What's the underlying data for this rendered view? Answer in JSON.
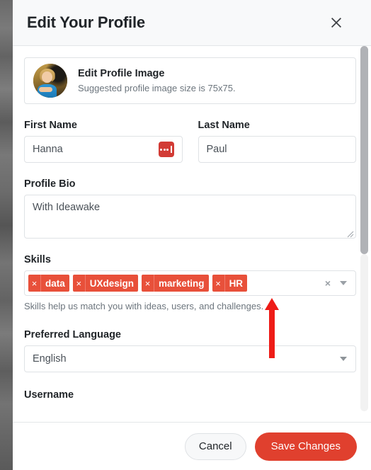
{
  "modal": {
    "title": "Edit Your Profile",
    "close_icon": "close-icon"
  },
  "profile_image_card": {
    "title": "Edit Profile Image",
    "subtitle": "Suggested profile image size is 75x75.",
    "avatar_alt": "user-avatar"
  },
  "fields": {
    "first_name": {
      "label": "First Name",
      "value": "Hanna",
      "placeholder": "First Name",
      "addon_icon": "lastpass-icon"
    },
    "last_name": {
      "label": "Last Name",
      "value": "Paul",
      "placeholder": "Last Name"
    },
    "profile_bio": {
      "label": "Profile Bio",
      "value": "With Ideawake",
      "placeholder": "Profile Bio"
    },
    "skills": {
      "label": "Skills",
      "chips": [
        "data",
        "UXdesign",
        "marketing",
        "HR"
      ],
      "remove_glyph": "×",
      "clear_glyph": "×",
      "help_text": "Skills help us match you with ideas, users, and challenges.",
      "placeholder": "Select skills"
    },
    "preferred_language": {
      "label": "Preferred Language",
      "value": "English",
      "options": [
        "English"
      ]
    },
    "username": {
      "label": "Username"
    }
  },
  "footer": {
    "cancel_label": "Cancel",
    "save_label": "Save Changes"
  },
  "colors": {
    "accent_red": "#e0402e",
    "chip_red": "#e8503a",
    "lastpass_red": "#d23b35",
    "annotation_red": "#ee1c17",
    "header_bg": "#f8f9fa",
    "border": "#dfe2e5",
    "muted_text": "#6c757d"
  },
  "annotation": {
    "arrow_icon": "up-arrow-annotation",
    "points_at": "skills-multiselect"
  }
}
